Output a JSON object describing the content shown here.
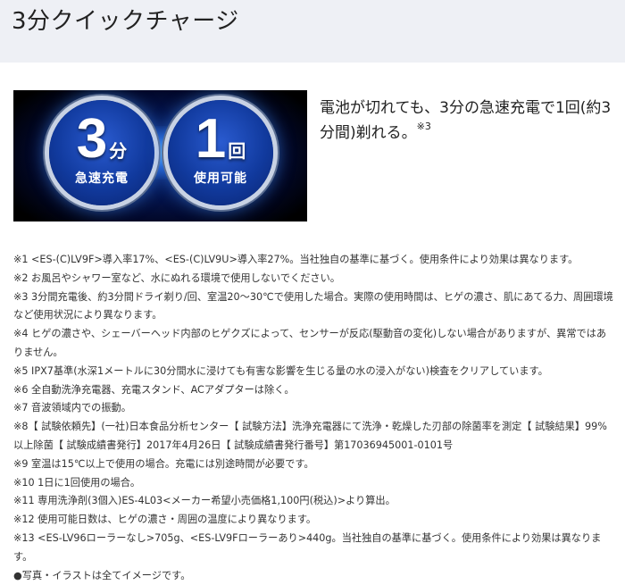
{
  "header": {
    "title": "3分クイックチャージ"
  },
  "hero": {
    "left_badge": {
      "number": "3",
      "unit": "分",
      "caption": "急速充電"
    },
    "right_badge": {
      "number": "1",
      "unit": "回",
      "caption": "使用可能"
    }
  },
  "description": {
    "text": "電池が切れても、3分の急速充電で1回(約3分間)剃れる。",
    "note_ref": "※3"
  },
  "notes": [
    "※1 <ES-(C)LV9F>導入率17%、<ES-(C)LV9U>導入率27%。当社独自の基準に基づく。使用条件により効果は異なります。",
    "※2 お風呂やシャワー室など、水にぬれる環境で使用しないでください。",
    "※3 3分間充電後、約3分間ドライ剃り/回、室温20～30℃で使用した場合。実際の使用時間は、ヒゲの濃さ、肌にあてる力、周囲環境など使用状況により異なります。",
    "※4 ヒゲの濃さや、シェーバーヘッド内部のヒゲクズによって、センサーが反応(駆動音の変化)しない場合がありますが、異常ではありません。",
    "※5 IPX7基準(水深1メートルに30分間水に浸けても有害な影響を生じる量の水の浸入がない)検査をクリアしています。",
    "※6 全自動洗浄充電器、充電スタンド、ACアダプターは除く。",
    "※7 音波領域内での振動。",
    "※8【 試験依頼先】(一社)日本食品分析センター【 試験方法】洗浄充電器にて洗浄・乾燥した刃部の除菌率を測定【 試験結果】99%以上除菌【 試験成績書発行】2017年4月26日【 試験成績書発行番号】第17036945001-0101号",
    "※9 室温は15℃以上で使用の場合。充電には別途時間が必要です。",
    "※10 1日に1回使用の場合。",
    "※11 専用洗浄剤(3個入)ES-4L03<メーカー希望小売価格1,100円(税込)>より算出。",
    "※12 使用可能日数は、ヒゲの濃さ・周囲の温度により異なります。",
    "※13 <ES-LV96ローラーなし>705g、<ES-LV9Fローラーあり>440g。当社独自の基準に基づく。使用条件により効果は異なります。",
    "●写真・イラストは全てイメージです。"
  ]
}
